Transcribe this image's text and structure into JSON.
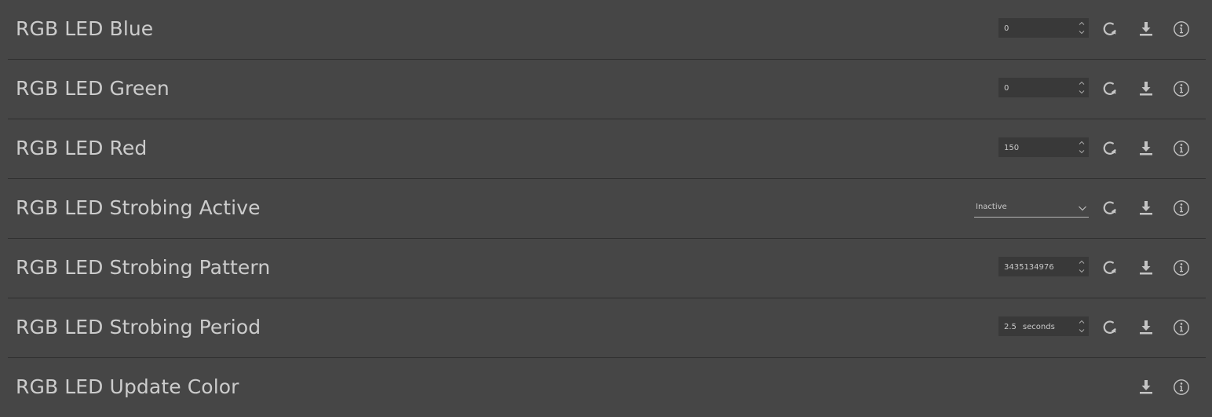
{
  "icons": {
    "refresh": "refresh-icon",
    "download": "download-icon",
    "info": "info-icon",
    "spin_up": "chevron-up-icon",
    "spin_down": "chevron-down-icon",
    "dropdown": "chevron-down-icon"
  },
  "colors": {
    "background": "#464646",
    "input_background": "#393939",
    "divider": "#2f2f2f",
    "text": "#cccccc",
    "icon": "#c4c4c4"
  },
  "features": [
    {
      "label": "RGB LED Blue",
      "control": "spinbox",
      "value": "0",
      "unit": ""
    },
    {
      "label": "RGB LED Green",
      "control": "spinbox",
      "value": "0",
      "unit": ""
    },
    {
      "label": "RGB LED Red",
      "control": "spinbox",
      "value": "150",
      "unit": ""
    },
    {
      "label": "RGB LED Strobing Active",
      "control": "combo",
      "value": "Inactive",
      "unit": ""
    },
    {
      "label": "RGB LED Strobing Pattern",
      "control": "spinbox",
      "value": "3435134976",
      "unit": ""
    },
    {
      "label": "RGB LED Strobing Period",
      "control": "spinbox",
      "value": "2.5",
      "unit": "seconds"
    },
    {
      "label": "RGB LED Update Color",
      "control": "command",
      "value": "",
      "unit": ""
    }
  ]
}
